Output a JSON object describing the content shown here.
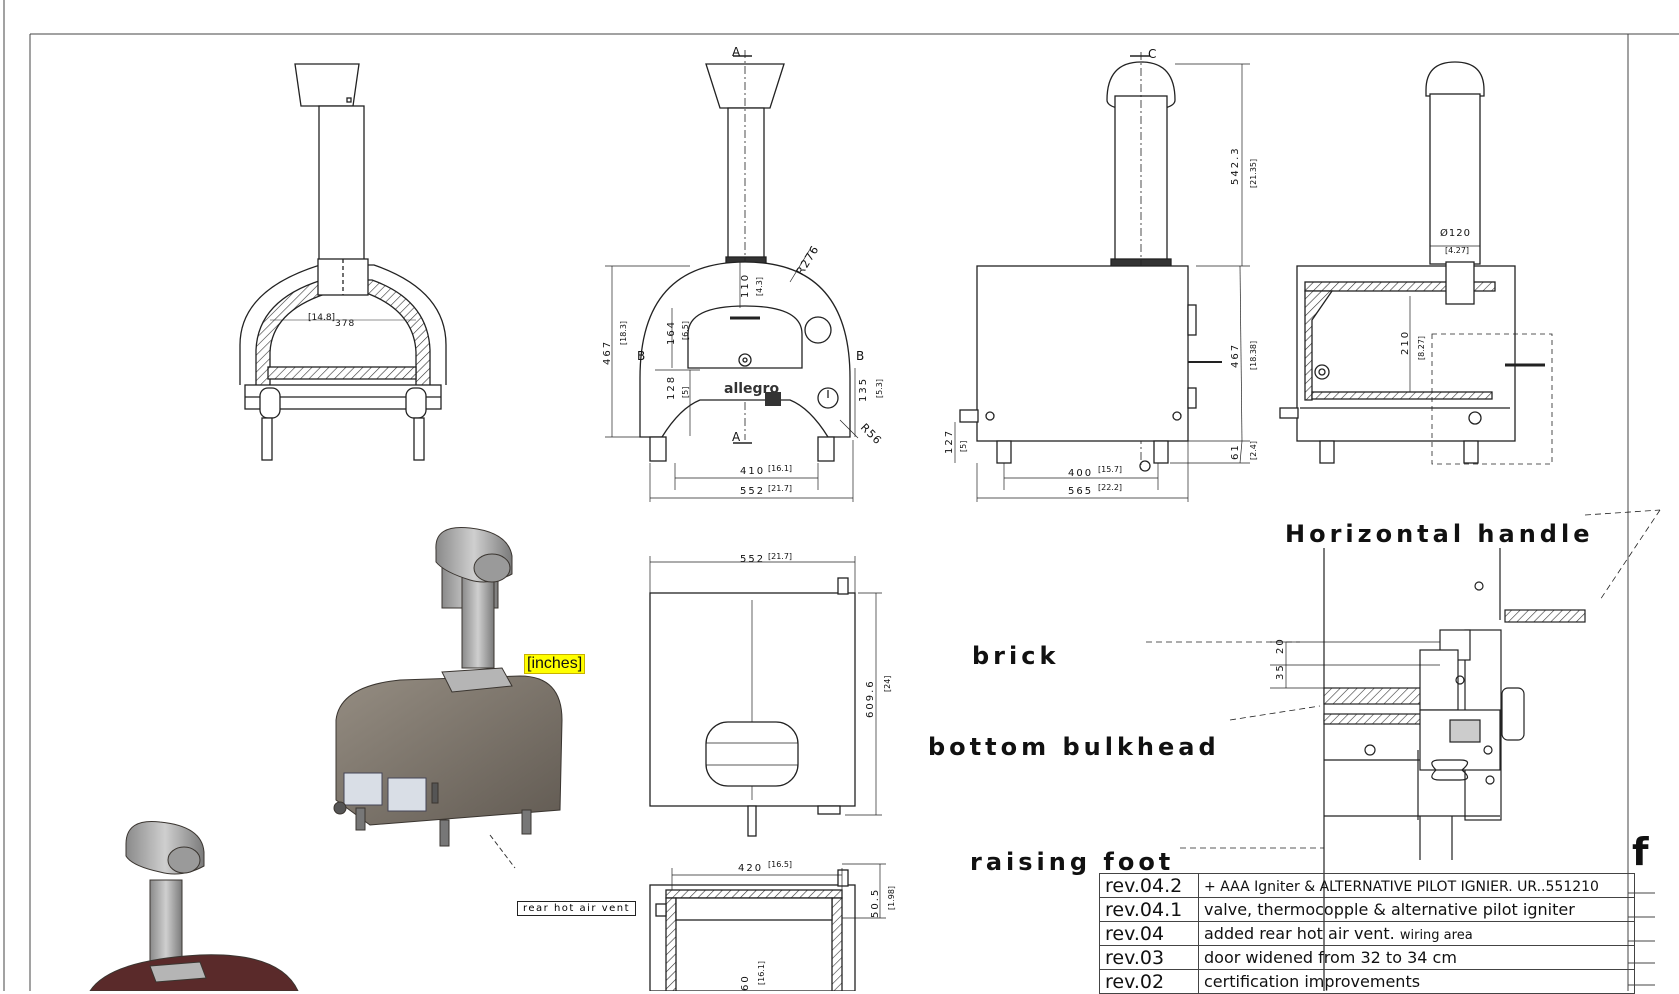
{
  "views": {
    "front_section": {
      "dim_top": "[14.8]",
      "dim_top_mm": "378"
    },
    "front_view": {
      "section_a": "A",
      "section_b": "B",
      "radius_top": "R276",
      "radius_bottom": "R56",
      "height_total": "467",
      "height_total_in": "[18.3]",
      "door_height": "164",
      "door_height_in": "[6.5]",
      "door_top_gap": "110",
      "door_top_gap_in": "[4.3]",
      "base_height": "128",
      "base_height_in": "[5]",
      "knob_height": "135",
      "knob_height_in": "[5.3]",
      "width_inner": "410",
      "width_inner_in": "[16.1]",
      "width_outer": "552",
      "width_outer_in": "[21.7]",
      "logo": "allegro"
    },
    "side_view": {
      "section_c": "C",
      "chimney_height": "542.3",
      "chimney_height_in": "[21.35]",
      "body_height": "467",
      "body_height_in": "[18.38]",
      "foot_height": "61",
      "foot_height_in": "[2.4]",
      "gas_height": "127",
      "gas_height_in": "[5]",
      "feet_spacing": "400",
      "feet_spacing_in": "[15.7]",
      "length": "565",
      "length_in": "[22.2]"
    },
    "side_section": {
      "flue_dia": "Ø120",
      "flue_dia_in": "[4.27]",
      "inner_height": "210",
      "inner_height_in": "[8.27]"
    },
    "top_view": {
      "width": "552",
      "width_in": "[21.7]",
      "depth": "609.6",
      "depth_in": "[24]"
    },
    "bottom_section": {
      "width": "420",
      "width_in": "[16.5]",
      "depth_top": "50.5",
      "depth_top_in": "[1.98]",
      "depth_mid": "60",
      "depth_mid_in": "[16.1]"
    },
    "detail": {
      "dim_a": "35",
      "dim_b": "20"
    }
  },
  "labels": {
    "inches_note": "[inches]",
    "rear_vent": "rear hot air vent",
    "horizontal_handle": "Horizontal handle",
    "brick": "brick",
    "bottom_bulkhead": "bottom bulkhead",
    "raising_foot": "raising foot",
    "sheet_letter": "f"
  },
  "revisions": [
    {
      "rev": "rev.04.2",
      "desc": "+ AAA Igniter & ALTERNATIVE PILOT IGNIER. UR..551210"
    },
    {
      "rev": "rev.04.1",
      "desc": "valve, thermocopple & alternative pilot igniter"
    },
    {
      "rev": "rev.04",
      "desc": "added rear hot air vent.",
      "note": "wiring area"
    },
    {
      "rev": "rev.03",
      "desc": "door widened from 32 to 34 cm"
    },
    {
      "rev": "rev.02",
      "desc": "certification improvements"
    }
  ],
  "colors": {
    "line": "#222222",
    "body_3d": "#7d766c",
    "highlight": "#ffff00"
  }
}
